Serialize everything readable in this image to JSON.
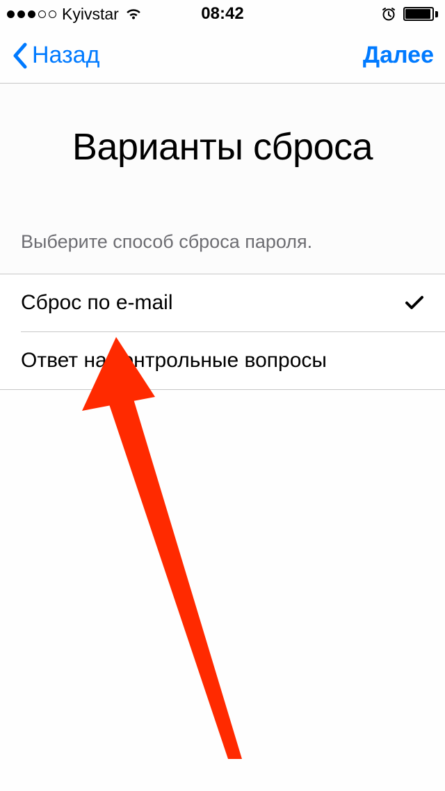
{
  "status_bar": {
    "carrier": "Kyivstar",
    "time": "08:42"
  },
  "nav": {
    "back_label": "Назад",
    "next_label": "Далее"
  },
  "page": {
    "title": "Варианты сброса",
    "instruction": "Выберите способ сброса пароля."
  },
  "options": [
    {
      "label": "Сброс по e-mail",
      "selected": true
    },
    {
      "label": "Ответ на контрольные вопросы",
      "selected": false
    }
  ],
  "colors": {
    "tint": "#007AFF",
    "annotation": "#ff2a00"
  }
}
